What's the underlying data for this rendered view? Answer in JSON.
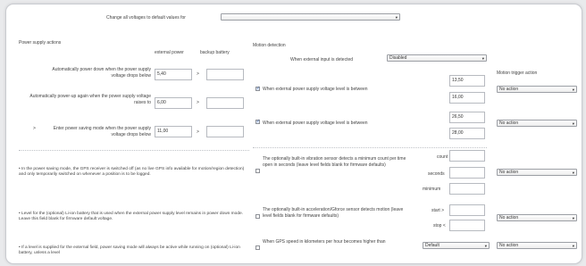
{
  "top": {
    "label": "Change all voltages to default values for",
    "select_value": ""
  },
  "power": {
    "title": "Power supply actions",
    "col_external": "external power",
    "col_backup": "backup battery",
    "rows": [
      {
        "label": "Automatically power down when the power supply voltage drops below",
        "external": "5,40",
        "backup": ""
      },
      {
        "label": "Automatically power-up again when the power supply voltage raises to",
        "external": "6,00",
        "backup": ""
      },
      {
        "label": "Enter power saving mode when the power supply voltage drops below",
        "external": "11,00",
        "backup": ""
      }
    ],
    "notes": [
      "In the power saving mode, the GPS receiver is switched off (as no live GPS info available for motion/region detection) and only temporarily switched on whenever a position is to be logged.",
      "Level for the (optional) Li-ion battery that is used when the external power supply level remains in power down mode. Leave this field blank for firmware default voltage.",
      "If a level is supplied for the external field, power saving mode will always be active while running on (optional) Li-ion battery, unless a level"
    ]
  },
  "motion": {
    "title": "Motion detection",
    "external_input_label": "When external input is detected",
    "external_input_value": "Disabled",
    "trigger_header": "Motion trigger action",
    "voltage_rows": [
      {
        "label": "When external power supply voltage level is between",
        "checked": true,
        "low": "13,50",
        "high": "16,00",
        "action": "No action"
      },
      {
        "label": "When external power supply voltage level is between",
        "checked": true,
        "low": "26,50",
        "high": "28,00",
        "action": "No action"
      }
    ],
    "vibration": {
      "label": "The optionally built-in vibration sensor detects a minimum count per time open in seconds (leave level fields blank for firmware defaults)",
      "count_label": "count",
      "seconds_label": "seconds",
      "minimum_label": "minimum",
      "count": "",
      "seconds": "",
      "minimum": "",
      "action": "No action"
    },
    "accel": {
      "label": "The optionally built-in acceleration/Gforce sensor detects motion (leave level fields blank for firmware defaults)",
      "start_label": "start >",
      "stop_label": "stop <",
      "start": "",
      "stop": "",
      "action": "No action"
    },
    "gps": {
      "label": "When GPS speed in kilometers per hour becomes higher than",
      "speed_value": "Default",
      "action": "No action"
    }
  },
  "icons": {
    "dropdown": "▾",
    "bullet": "•"
  }
}
